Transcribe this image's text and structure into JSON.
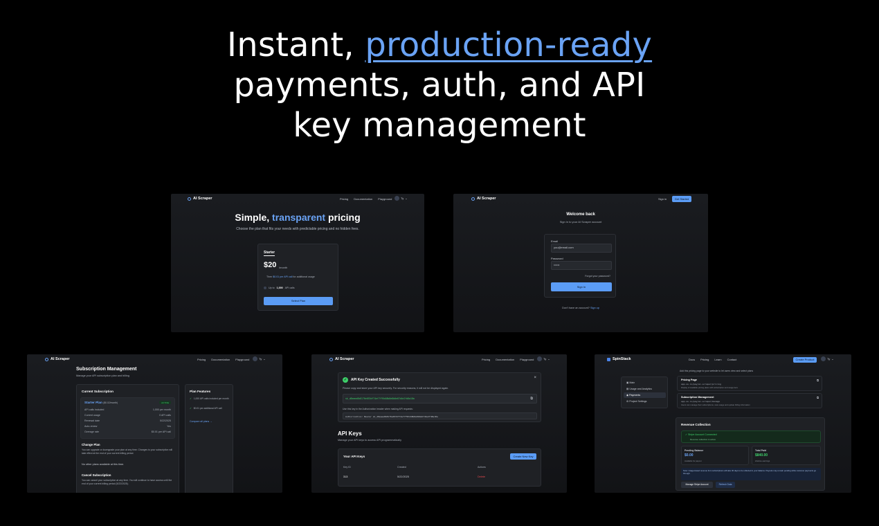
{
  "hero": {
    "line1_before": "Instant, ",
    "line1_highlight": "production-ready",
    "line2": "payments, auth, and API",
    "line3": "key management"
  },
  "pricing": {
    "logo": "AI Scraper",
    "nav": [
      "Pricing",
      "Documentation",
      "Playground"
    ],
    "user": "Ty",
    "title_before": "Simple, ",
    "title_highlight": "transparent",
    "title_after": " pricing",
    "subtitle": "Choose the plan that fits your needs with predictable pricing and no hidden fees.",
    "plan_name": "Starter",
    "price": "$20",
    "period": "/month",
    "overage_prefix": "Then ",
    "overage_value": "$0.01 per API call",
    "overage_suffix": " for additional usage",
    "feature_prefix": "Up to ",
    "feature_value": "1,000",
    "feature_suffix": " API calls",
    "cta": "Select Plan"
  },
  "signin": {
    "logo": "AI Scraper",
    "sign_in_link": "Sign in",
    "get_started": "Get Started",
    "title": "Welcome back",
    "subtitle": "Sign in to your AI Scraper account",
    "email_label": "Email",
    "email_value": "you@email.com",
    "password_label": "Password",
    "password_value": "••••••",
    "forgot": "Forgot your password?",
    "submit": "Sign In",
    "no_account": "Don't have an account? ",
    "sign_up": "Sign up"
  },
  "subscription": {
    "logo": "AI Scraper",
    "nav": [
      "Pricing",
      "Documentation",
      "Playground"
    ],
    "user": "Ty",
    "title": "Subscription Management",
    "subtitle": "Manage your API subscription plan and billing",
    "current_heading": "Current Subscription",
    "plan_label": "Starter Plan",
    "plan_price": "($0.02/month)",
    "status": "ACTIVE",
    "rows": [
      {
        "label": "API calls included",
        "value": "1,000 per month"
      },
      {
        "label": "Current usage",
        "value": "0 API calls"
      },
      {
        "label": "Renewal date",
        "value": "5/22/2025"
      },
      {
        "label": "Auto-renew",
        "value": "Yes"
      },
      {
        "label": "Overage rate",
        "value": "$0.01 per API call"
      }
    ],
    "change_heading": "Change Plan",
    "change_text": "You can upgrade or downgrade your plan at any time. Changes to your subscription will take effect at the end of your current billing period.",
    "no_plans": "No other plans available at this time.",
    "cancel_heading": "Cancel Subscription",
    "cancel_text": "You can cancel your subscription at any time. You will continue to have access until the end of your current billing period (5/22/2025).",
    "features_heading": "Plan Features",
    "features": [
      "1,000 API calls included per month",
      "$0.01 per additional API call"
    ],
    "compare": "Compare all plans →"
  },
  "apikeys": {
    "logo": "AI Scraper",
    "nav": [
      "Pricing",
      "Documentation",
      "Playground"
    ],
    "user": "Ty",
    "banner_title": "API Key Created Successfully",
    "banner_text": "Please copy and store your API key securely. For security reasons, it will not be displayed again.",
    "key_value": "sk_d8eaea8b8176e653df74ef7f95d48b8e8b0e67d4e2fd8a18a",
    "header_hint": "Use this key in the Authorization header when making API requests:",
    "header_value": "Authorization: Bearer sk_d8eaea8b8176e653df74ef7f95d48b8e8b0e67d4e2fd8a18a",
    "title": "API Keys",
    "subtitle": "Manage your API keys to access API programmatically",
    "your_keys": "Your API Keys",
    "create": "Create New Key",
    "columns": [
      "Key ID",
      "Created",
      "Actions"
    ],
    "row": {
      "id": "313",
      "created": "5/22/2025",
      "action": "Delete"
    }
  },
  "payments": {
    "logo": "SpinStack",
    "nav": [
      "Docs",
      "Pricing",
      "Learn",
      "Contact"
    ],
    "create_product": "Create Product",
    "user": "Ty",
    "sidebar": [
      "Main",
      "Usage and Analytics",
      "Payments",
      "Project Settings"
    ],
    "intro": "Add this pricing page to your website to let users view and select plans",
    "pricing_page_title": "Pricing Page",
    "pricing_page_url": "app.ss.io/pay/ai-scraper/pricing",
    "pricing_page_desc": "Display of available pricing plans with subscription and usage tiers",
    "sub_mgmt_title": "Subscription Management",
    "sub_mgmt_url": "app.ss.io/pay/ai-scraper/manage",
    "sub_mgmt_desc": "Users can manage their subscriptions, view usage and update billing information",
    "revenue_heading": "Revenue Collection",
    "stripe_connected": "Stripe Account Connected",
    "stripe_sub": "Revenue collection is active",
    "pending_label": "Pending Balance",
    "pending_value": "$0.00",
    "pending_sub": "Available for payout",
    "total_label": "Total Paid",
    "total_value": "$840.00",
    "total_sub": "Lifetime earnings",
    "note": "Note: Usage-based revenue from subscriptions will take 30 days to be reflected in your balance. Payouts may remain pending while customer payments go through.",
    "manage_btn": "Manage Stripe Account",
    "refresh_btn": "Refresh Data"
  },
  "colors": {
    "accent": "#6aa3f5",
    "success": "#3ecf6a",
    "danger": "#e5484d"
  }
}
